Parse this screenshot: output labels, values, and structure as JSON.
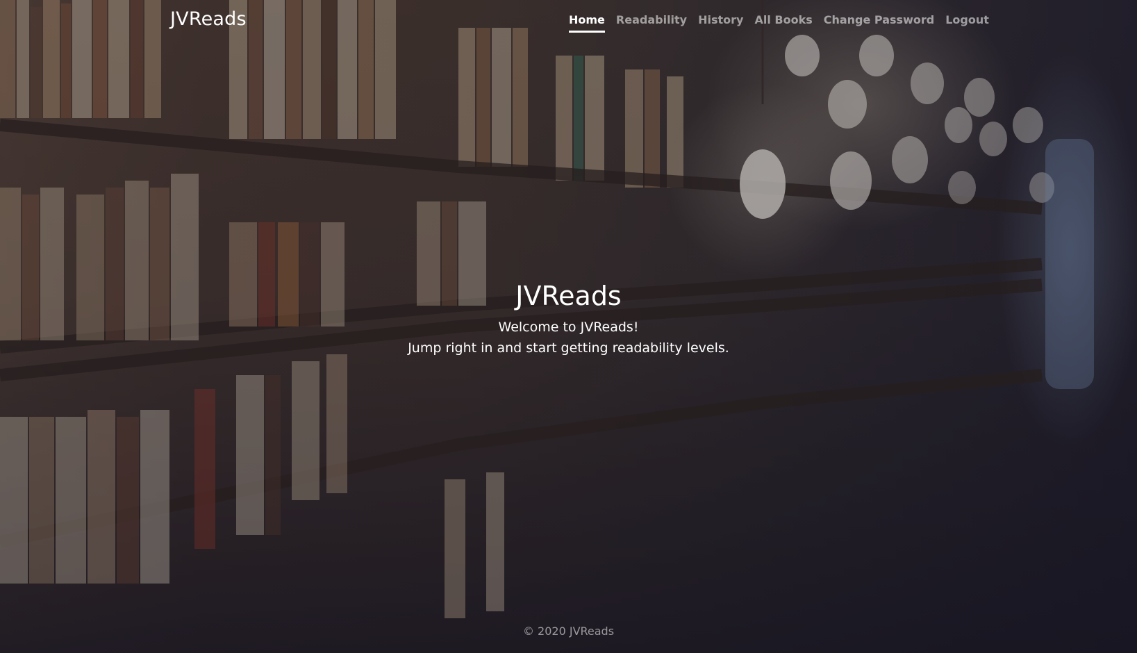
{
  "header": {
    "brand": "JVReads",
    "nav": [
      {
        "label": "Home",
        "active": true
      },
      {
        "label": "Readability",
        "active": false
      },
      {
        "label": "History",
        "active": false
      },
      {
        "label": "All Books",
        "active": false
      },
      {
        "label": "Change Password",
        "active": false
      },
      {
        "label": "Logout",
        "active": false
      }
    ]
  },
  "hero": {
    "title": "JVReads",
    "line1": "Welcome to JVReads!",
    "line2": "Jump right in and start getting readability levels."
  },
  "footer": {
    "text": "© 2020 JVReads"
  },
  "background": {
    "image": "library-bookshelves-photo",
    "overlay_color": "#181624"
  }
}
